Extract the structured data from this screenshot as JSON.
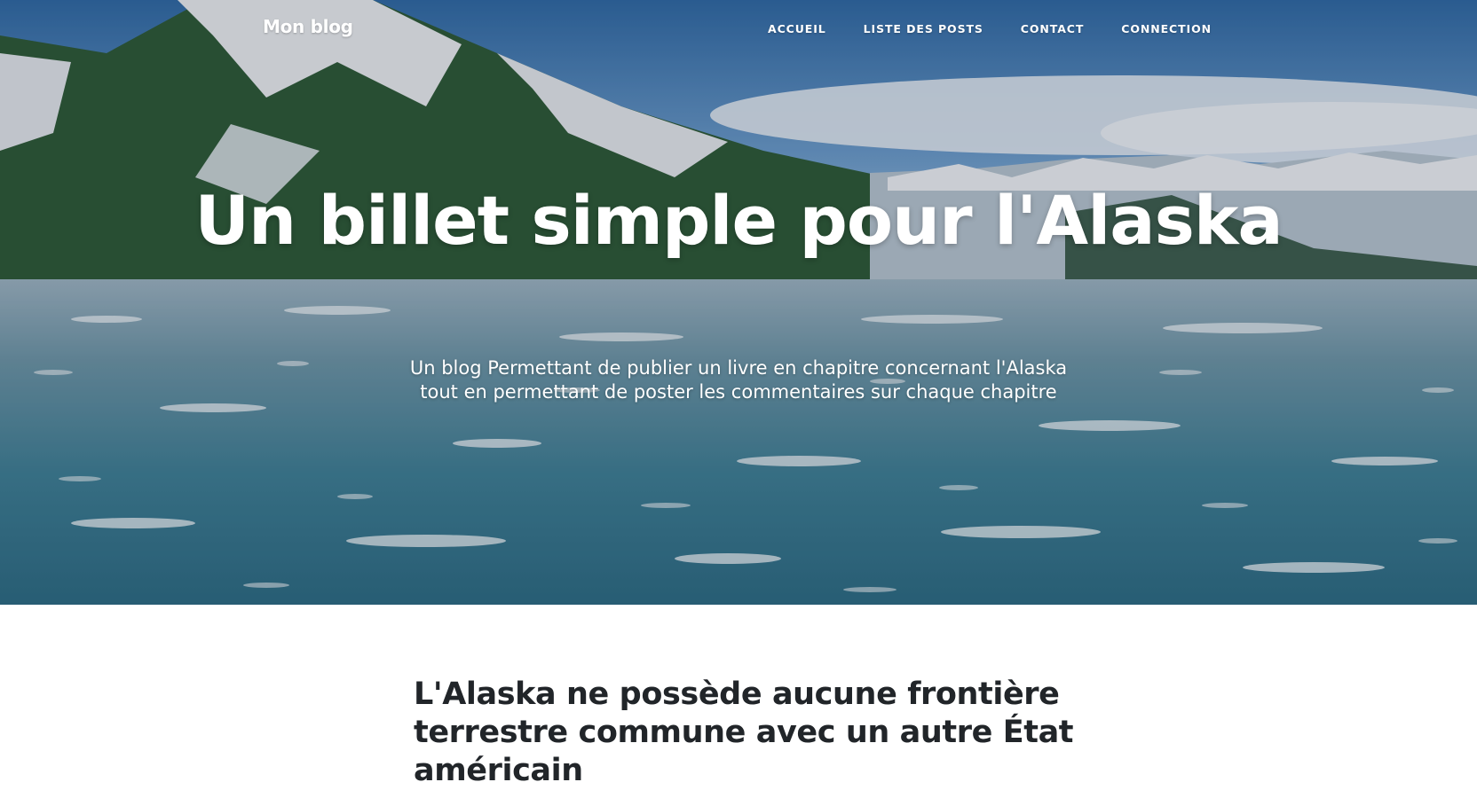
{
  "navbar": {
    "brand": "Mon blog",
    "links": [
      "ACCUEIL",
      "LISTE DES POSTS",
      "CONTACT",
      "CONNECTION"
    ]
  },
  "hero": {
    "heading": "Un billet simple pour l'Alaska",
    "subheading": "Un blog Permettant de publier un livre en chapitre concernant l'Alaska tout en permettant de poster les commentaires sur chaque chapitre"
  },
  "posts": [
    {
      "title": "L'Alaska ne possède aucune frontière terrestre commune avec un autre État américain"
    }
  ]
}
